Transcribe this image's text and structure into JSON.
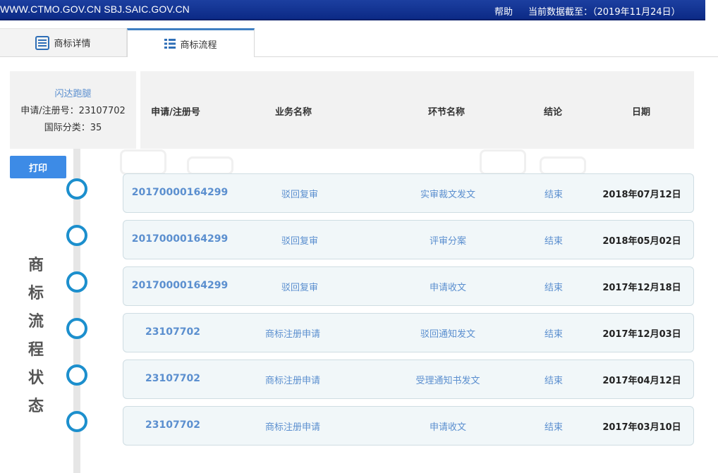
{
  "topbar": {
    "sites": "WWW.CTMO.GOV.CN SBJ.SAIC.GOV.CN",
    "help": "帮助",
    "asof": "当前数据截至：（2019年11月24日）"
  },
  "tabs": [
    {
      "label": "商标详情",
      "icon": "document-list-icon",
      "active": false
    },
    {
      "label": "商标流程",
      "icon": "list-icon",
      "active": true
    }
  ],
  "info": {
    "name": "闪达跑腿",
    "reg_no": "申请/注册号：23107702",
    "class": "国际分类：35"
  },
  "columns": [
    "申请/注册号",
    "业务名称",
    "环节名称",
    "结论",
    "日期"
  ],
  "print_label": "打印",
  "side_title": [
    "商",
    "标",
    "流",
    "程",
    "状",
    "态"
  ],
  "rows": [
    {
      "number": "20170000164299",
      "business": "驳回复审",
      "step": "实审裁文发文",
      "result": "结束",
      "date": "2018年07月12日"
    },
    {
      "number": "20170000164299",
      "business": "驳回复审",
      "step": "评审分案",
      "result": "结束",
      "date": "2018年05月02日"
    },
    {
      "number": "20170000164299",
      "business": "驳回复审",
      "step": "申请收文",
      "result": "结束",
      "date": "2017年12月18日"
    },
    {
      "number": "23107702",
      "business": "商标注册申请",
      "step": "驳回通知发文",
      "result": "结束",
      "date": "2017年12月03日"
    },
    {
      "number": "23107702",
      "business": "商标注册申请",
      "step": "受理通知书发文",
      "result": "结束",
      "date": "2017年04月12日"
    },
    {
      "number": "23107702",
      "business": "商标注册申请",
      "step": "申请收文",
      "result": "结束",
      "date": "2017年03月10日"
    }
  ],
  "colors": {
    "accent": "#3d8be6",
    "banner": "#0c2a86",
    "dot": "#1c8fcd",
    "link": "#5b8fcf"
  }
}
